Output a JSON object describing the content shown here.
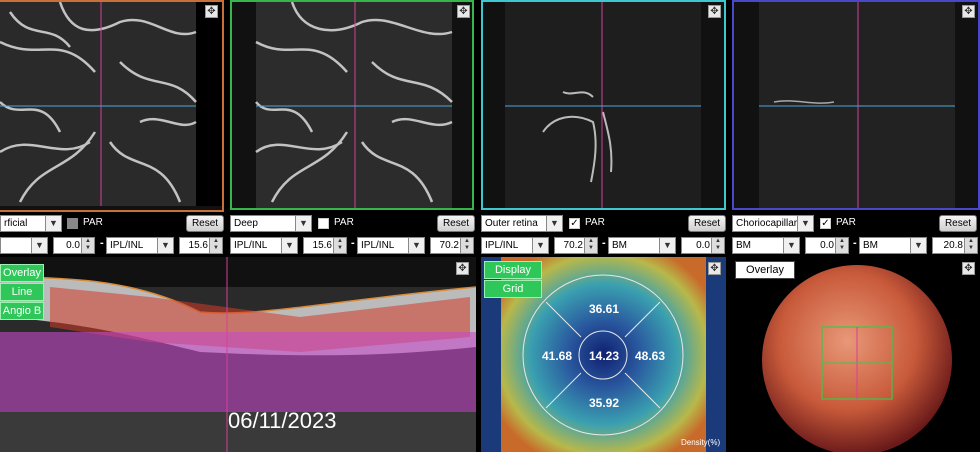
{
  "colors": {
    "superficial": "#c8703a",
    "deep": "#35b54a",
    "outer": "#3fc7cf",
    "chorio": "#4848c8",
    "crosshair_v": "#d4409a",
    "crosshair_h": "#4aa8d8"
  },
  "icons": {
    "expand": "expand-icon"
  },
  "panels": [
    {
      "name": "superficial",
      "layer": "rficial",
      "par_label": "PAR",
      "par_checked": false,
      "reset": "Reset",
      "top_sel": "",
      "top_val": "0.0",
      "bot_sel": "IPL/INL",
      "bot_val": "15.6"
    },
    {
      "name": "deep",
      "layer": "Deep",
      "par_label": "PAR",
      "par_checked": false,
      "reset": "Reset",
      "top_sel": "IPL/INL",
      "top_val": "15.6",
      "bot_sel": "IPL/INL",
      "bot_val": "70.2"
    },
    {
      "name": "outer",
      "layer": "Outer retina",
      "par_label": "PAR",
      "par_checked": true,
      "reset": "Reset",
      "top_sel": "IPL/INL",
      "top_val": "70.2",
      "bot_sel": "BM",
      "bot_val": "0.0"
    },
    {
      "name": "chorio",
      "layer": "Choriocapillaris",
      "par_label": "PAR",
      "par_checked": true,
      "reset": "Reset",
      "top_sel": "BM",
      "top_val": "0.0",
      "bot_sel": "BM",
      "bot_val": "20.8"
    }
  ],
  "bscan": {
    "buttons": [
      "Overlay",
      "Line",
      "Angio B"
    ],
    "date": "06/11/2023"
  },
  "density": {
    "buttons": [
      "Display",
      "Grid"
    ],
    "center": "14.23",
    "top": "36.61",
    "left": "41.68",
    "right": "48.63",
    "bottom": "35.92",
    "legend": "Density(%)"
  },
  "fundus": {
    "button": "Overlay"
  }
}
